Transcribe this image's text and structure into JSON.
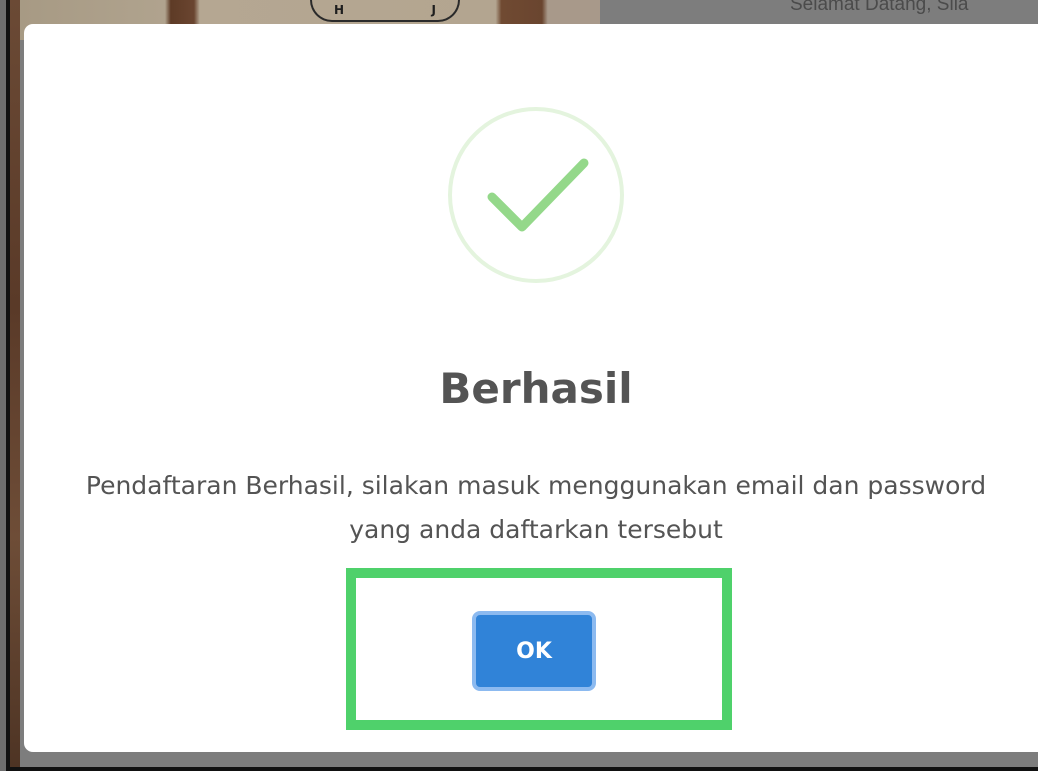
{
  "background": {
    "emblem_letters": [
      "H",
      "J"
    ],
    "welcome_text": "Selamat Datang, Sila"
  },
  "modal": {
    "icon": "success-check-icon",
    "title": "Berhasil",
    "message": "Pendaftaran Berhasil, silakan masuk menggunakan email dan password yang anda daftarkan tersebut",
    "ok_label": "OK"
  },
  "colors": {
    "accent_button": "#3083d8",
    "success_check": "#94d88a",
    "success_ring": "#e4f4de",
    "highlight_box": "#4fd16b",
    "text": "#545454"
  }
}
